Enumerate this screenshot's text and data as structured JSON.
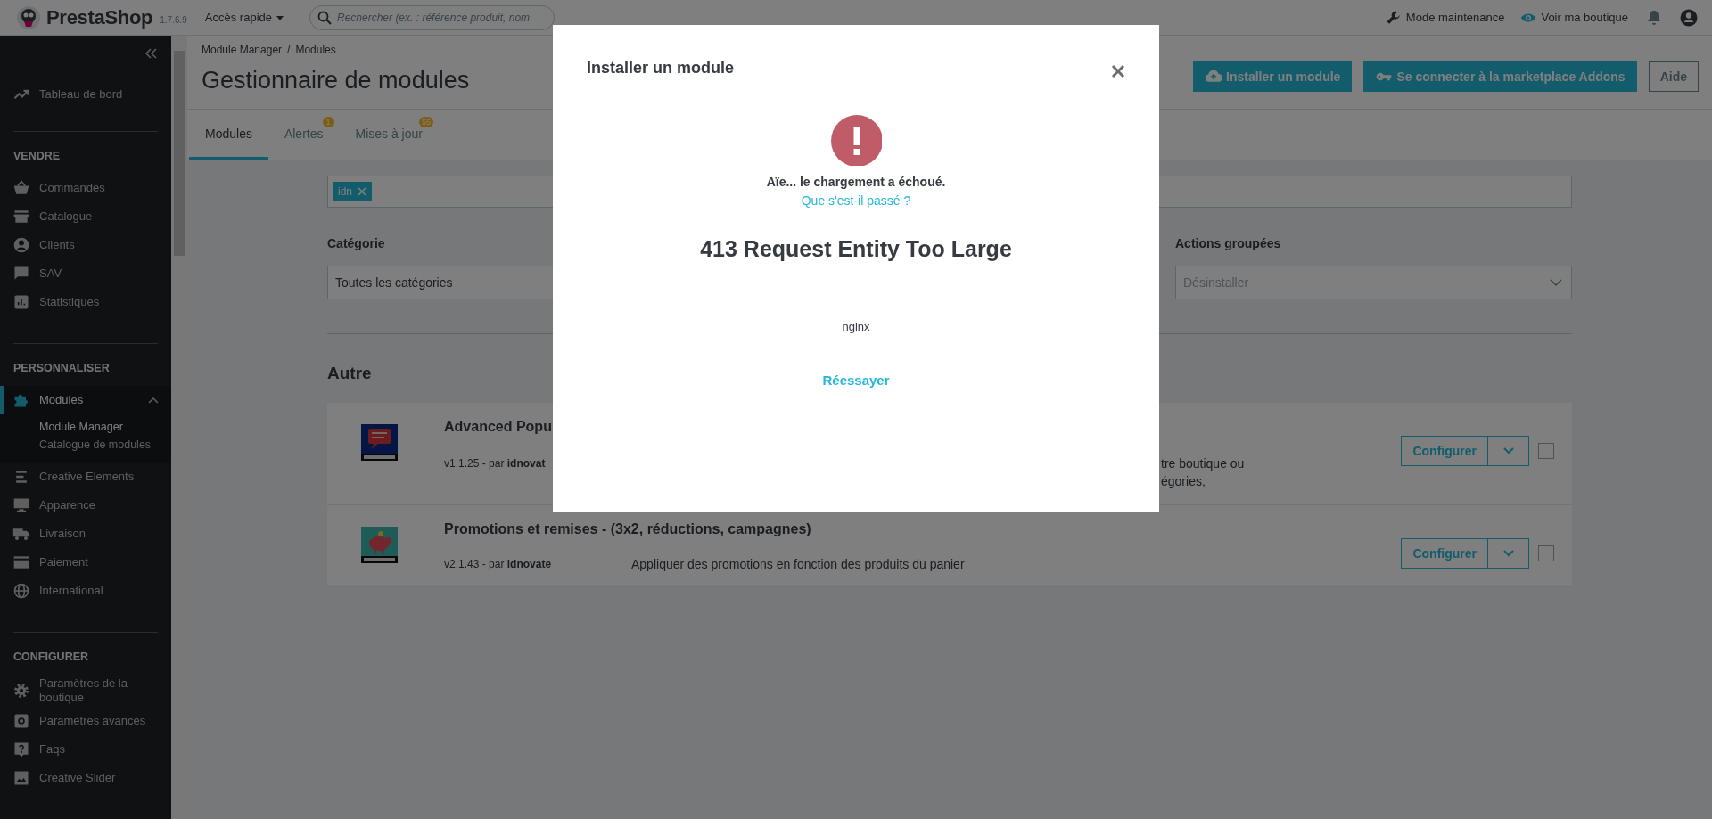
{
  "topbar": {
    "logo": "PrestaShop",
    "version": "1.7.6.9",
    "quick_access": "Accès rapide",
    "search": {
      "placeholder": "Rechercher (ex. : référence produit, nom"
    },
    "links": [
      {
        "label": "Mode maintenance"
      },
      {
        "label": "Voir ma boutique"
      }
    ]
  },
  "sidebar": {
    "top_items": [
      {
        "label": "Tableau de bord",
        "selected": false
      }
    ],
    "sections": [
      {
        "title": "VENDRE",
        "items": [
          {
            "label": "Commandes",
            "selected": false
          },
          {
            "label": "Catalogue",
            "selected": false
          },
          {
            "label": "Clients",
            "selected": false
          },
          {
            "label": "SAV",
            "selected": false
          },
          {
            "label": "Statistiques",
            "selected": false
          }
        ]
      },
      {
        "title": "PERSONNALISER",
        "items": [
          {
            "label": "Modules",
            "selected": true,
            "expanded": true,
            "children": [
              {
                "label": "Module Manager",
                "selected": true
              },
              {
                "label": "Catalogue de modules",
                "selected": false
              }
            ]
          },
          {
            "label": "Creative Elements",
            "selected": false
          },
          {
            "label": "Apparence",
            "selected": false
          },
          {
            "label": "Livraison",
            "selected": false
          },
          {
            "label": "Paiement",
            "selected": false
          },
          {
            "label": "International",
            "selected": false
          }
        ]
      },
      {
        "title": "CONFIGURER",
        "items": [
          {
            "label": "Paramètres de la boutique",
            "selected": false
          },
          {
            "label": "Paramètres avancés",
            "selected": false
          },
          {
            "label": "Faqs",
            "selected": false
          },
          {
            "label": "Creative Slider",
            "selected": false
          }
        ]
      }
    ]
  },
  "header": {
    "breadcrumb": {
      "items": [
        "Module Manager",
        "Modules"
      ],
      "separator": "/"
    },
    "title": "Gestionnaire de modules",
    "buttons": [
      {
        "label": "Installer un module",
        "kind": "primary"
      },
      {
        "label": "Se connecter à la marketplace Addons",
        "kind": "primary"
      },
      {
        "label": "Aide",
        "kind": "outline"
      }
    ]
  },
  "tabs": [
    {
      "label": "Modules",
      "selected": true
    },
    {
      "label": "Alertes",
      "selected": false,
      "badge": "1"
    },
    {
      "label": "Mises à jour",
      "selected": false,
      "badge": "55"
    }
  ],
  "filters": {
    "tags": [
      {
        "label": "idn"
      }
    ],
    "category": {
      "label": "Catégorie",
      "value": "Toutes les catégories"
    },
    "bulk_actions": {
      "label": "Actions groupées",
      "value": "Désinstaller"
    }
  },
  "section_title": "Autre",
  "modules": [
    {
      "name": "Advanced Popu",
      "meta": "v1.1.25 - par **idnovat**",
      "description_tail_lines": [
        "tre boutique ou",
        "égories,"
      ],
      "action": "Configurer",
      "checked": false
    },
    {
      "name": "Promotions et remises - (3x2, réductions, campagnes)",
      "meta": "v2.1.43 - par **idnovate**",
      "description": "Appliquer des promotions en fonction des produits du panier",
      "action": "Configurer",
      "checked": false
    }
  ],
  "modal": {
    "title": "Installer un module",
    "message": "Aïe... le chargement a échoué.",
    "help_link": "Que s'est-il passé ?",
    "error_title": "413 Request Entity Too Large",
    "error_detail": "nginx",
    "retry": "Réessayer"
  }
}
